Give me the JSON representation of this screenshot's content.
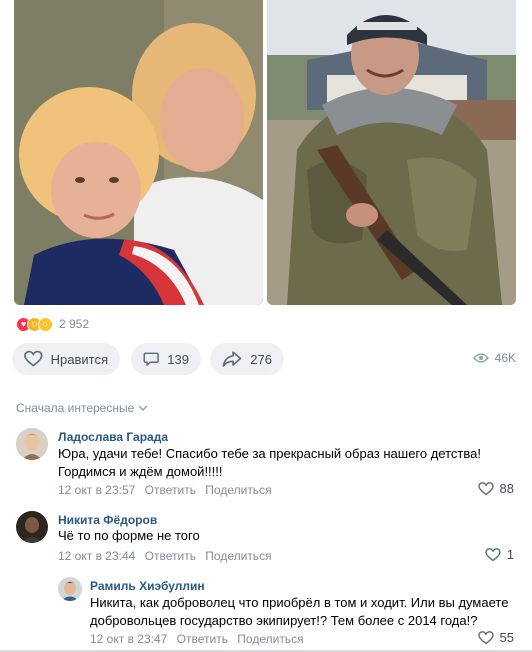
{
  "post": {
    "reaction_count": "2 952",
    "reactions": [
      "heart-icon",
      "laugh-icon",
      "wow-icon"
    ],
    "like_label": "Нравится",
    "comments_count": "139",
    "shares_count": "276",
    "views_count": "46K"
  },
  "comments_header": {
    "sort_label": "Сначала интересные"
  },
  "comments": [
    {
      "author": "Ладослава Гарада",
      "text_line1": "Юра, удачи тебе! Спасибо тебе за прекрасный образ нашего детства!",
      "text_line2": "Гордимся и ждём домой!!!!!",
      "time": "12 окт в 23:57",
      "reply_label": "Ответить",
      "share_label": "Поделиться",
      "likes": "88"
    },
    {
      "author": "Никита Фёдоров",
      "text_line1": "Чё то по форме не того",
      "time": "12 окт в 23:44",
      "reply_label": "Ответить",
      "share_label": "Поделиться",
      "likes": "1"
    },
    {
      "author": "Рамиль Хиэбуллин",
      "text_line1": "Никита, как доброволец что приобрёл в том и ходит. Или вы думаете",
      "text_line2": "добровольцев государство экипирует!? Тем более с 2014 года!?",
      "time": "12 окт в 23:47",
      "reply_label": "Ответить",
      "share_label": "Поделиться",
      "likes": "55"
    }
  ],
  "colors": {
    "link": "#2a5885",
    "secondary": "#818c99",
    "pill_bg": "#eef0f3",
    "heart": "#ff3347"
  }
}
